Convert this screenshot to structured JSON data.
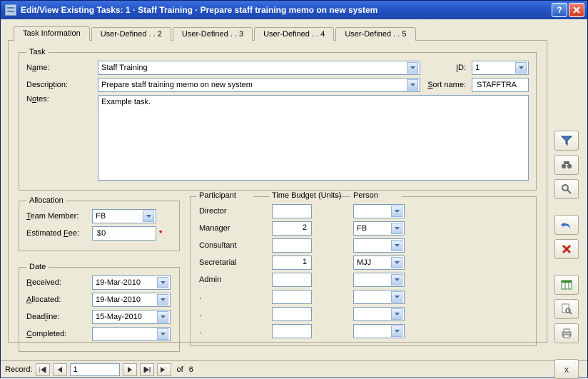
{
  "window": {
    "title": "Edit/View Existing Tasks:   1  ·  Staff Training  ·  Prepare staff training memo on new system"
  },
  "tabs": [
    {
      "label": "Task Information"
    },
    {
      "label": "User-Defined . . 2"
    },
    {
      "label": "User-Defined . . 3"
    },
    {
      "label": "User-Defined . . 4"
    },
    {
      "label": "User-Defined . . 5"
    }
  ],
  "task": {
    "legend": "Task",
    "name_label_pre": "N",
    "name_label_u": "a",
    "name_label_post": "me:",
    "name_value": "Staff Training",
    "id_label_pre": "",
    "id_label_u": "I",
    "id_label_post": "D:",
    "id_value": "1",
    "desc_label_pre": "Descri",
    "desc_label_u": "p",
    "desc_label_post": "tion:",
    "desc_value": "Prepare staff training memo on new system",
    "sort_label_pre": "",
    "sort_label_u": "S",
    "sort_label_post": "ort name:",
    "sort_value": "STAFFTRA",
    "notes_label_pre": "N",
    "notes_label_u": "o",
    "notes_label_post": "tes:",
    "notes_value": "Example task."
  },
  "allocation": {
    "legend": "Allocation",
    "team_label_pre": "",
    "team_label_u": "T",
    "team_label_post": "eam Member:",
    "team_value": "FB",
    "fee_label_pre": "Estimated ",
    "fee_label_u": "F",
    "fee_label_post": "ee:",
    "fee_value": "$0"
  },
  "date": {
    "legend": "Date",
    "received_label_pre": "",
    "received_label_u": "R",
    "received_label_post": "eceived:",
    "received_value": "19-Mar-2010",
    "allocated_label_pre": "",
    "allocated_label_u": "A",
    "allocated_label_post": "llocated:",
    "allocated_value": "19-Mar-2010",
    "deadline_label_pre": "Dead",
    "deadline_label_u": "l",
    "deadline_label_post": "ine:",
    "deadline_value": "15-May-2010",
    "completed_label_pre": "",
    "completed_label_u": "C",
    "completed_label_post": "ompleted:",
    "completed_value": ""
  },
  "participants": {
    "head_participant": "Participant",
    "head_budget": "Time Budget (Units)",
    "head_person": "Person",
    "rows": [
      {
        "role": "Director",
        "budget": "",
        "person": ""
      },
      {
        "role": "Manager",
        "budget": "2",
        "person": "FB"
      },
      {
        "role": "Consultant",
        "budget": "",
        "person": ""
      },
      {
        "role": "Secretarial",
        "budget": "1",
        "person": "MJJ"
      },
      {
        "role": "Admin",
        "budget": "",
        "person": ""
      },
      {
        "role": ".",
        "budget": "",
        "person": ""
      },
      {
        "role": ".",
        "budget": "",
        "person": ""
      },
      {
        "role": ".",
        "budget": "",
        "person": ""
      }
    ]
  },
  "sidebar": {
    "filter": "filter",
    "find": "find",
    "zoom": "zoom",
    "undo": "undo",
    "delete": "delete",
    "excel": "excel",
    "preview": "preview",
    "print": "print",
    "close": "close"
  },
  "status": {
    "label": "Record:",
    "current": "1",
    "of_label": "of",
    "total": "6"
  },
  "glyph": {
    "help": "?",
    "close": "✕",
    "closex": "x",
    "dot": "·",
    "first": "|◄",
    "prev": "◄",
    "next": "►",
    "last": "►|",
    "new": "►*"
  }
}
